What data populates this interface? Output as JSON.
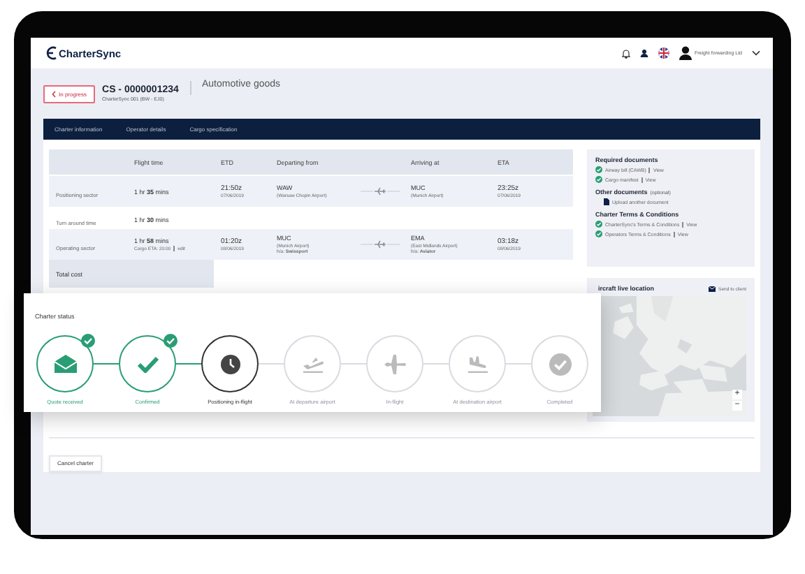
{
  "topbar": {
    "logo": "CharterSync",
    "user": "Freight forwarding Ltd"
  },
  "header": {
    "status": "In progress",
    "reference": "CS - 0000001234",
    "flight": "CharterSync 001 (BW - EJ0)",
    "title": "Automotive goods"
  },
  "tabs": [
    {
      "label": "Charter information"
    },
    {
      "label": "Operator details"
    },
    {
      "label": "Cargo specification"
    }
  ],
  "table": {
    "columns": {
      "flight_time": "Flight time",
      "etd": "ETD",
      "departing": "Departing from",
      "arriving": "Arriving at",
      "eta": "ETA"
    },
    "rows": [
      {
        "kind": "sector",
        "label": "Positioning sector",
        "flight_time": "1 hr **35** mins",
        "etd": "21:50z",
        "etd_date": "07/06/2019",
        "from_code": "WAW",
        "from_name": "(Warsaw Chopin Airport)",
        "to_code": "MUC",
        "to_name": "(Munich Airport)",
        "eta": "23:25z",
        "eta_date": "07/06/2019"
      },
      {
        "kind": "turnaround",
        "label": "Turn around time",
        "flight_time": "1 hr **30** mins"
      },
      {
        "kind": "sector",
        "label": "Operating sector",
        "flight_time": "1 hr **58** mins",
        "cargo_eta": "Cargo ETA: 20:00",
        "edit": "edit",
        "etd": "01:20z",
        "etd_date": "08/06/2019",
        "from_code": "MUC",
        "from_name": "(Munich Airport)",
        "from_handler": "h/a: **Swissport**",
        "to_code": "EMA",
        "to_name": "(East Midlands Airport)",
        "to_handler": "h/a: **Aviator**",
        "eta": "03:18z",
        "eta_date": "08/06/2019"
      }
    ],
    "total": "Total cost"
  },
  "documents": {
    "sections": [
      {
        "title": "Required documents",
        "items": [
          {
            "kind": "done",
            "label": "Airway bill (CAWB)",
            "link": "View"
          },
          {
            "kind": "done",
            "label": "Cargo manifest",
            "link": "View"
          }
        ]
      },
      {
        "title": "Other documents",
        "note": "(optional)",
        "items": [
          {
            "kind": "upload",
            "label": "Upload another document"
          }
        ]
      },
      {
        "title": "Charter Terms & Conditions",
        "items": [
          {
            "kind": "done",
            "label": "CharterSync's Terms & Conditions",
            "link": "View"
          },
          {
            "kind": "done",
            "label": "Operators Terms & Conditions",
            "link": "View"
          }
        ]
      }
    ]
  },
  "map": {
    "title": "ircraft live location",
    "send": "Send to client",
    "zoom_in": "+",
    "zoom_out": "−"
  },
  "status": {
    "title": "Charter status",
    "steps": [
      {
        "label": "Quote received",
        "done": true,
        "current": false
      },
      {
        "label": "Confirmed",
        "done": true,
        "current": false
      },
      {
        "label": "Positioning in-flight",
        "done": false,
        "current": true
      },
      {
        "label": "At departure airport",
        "done": false,
        "current": false
      },
      {
        "label": "In-flight",
        "done": false,
        "current": false
      },
      {
        "label": "At destination airport",
        "done": false,
        "current": false
      },
      {
        "label": "Completed",
        "done": false,
        "current": false
      }
    ]
  },
  "footer": {
    "cancel": "Cancel charter"
  }
}
